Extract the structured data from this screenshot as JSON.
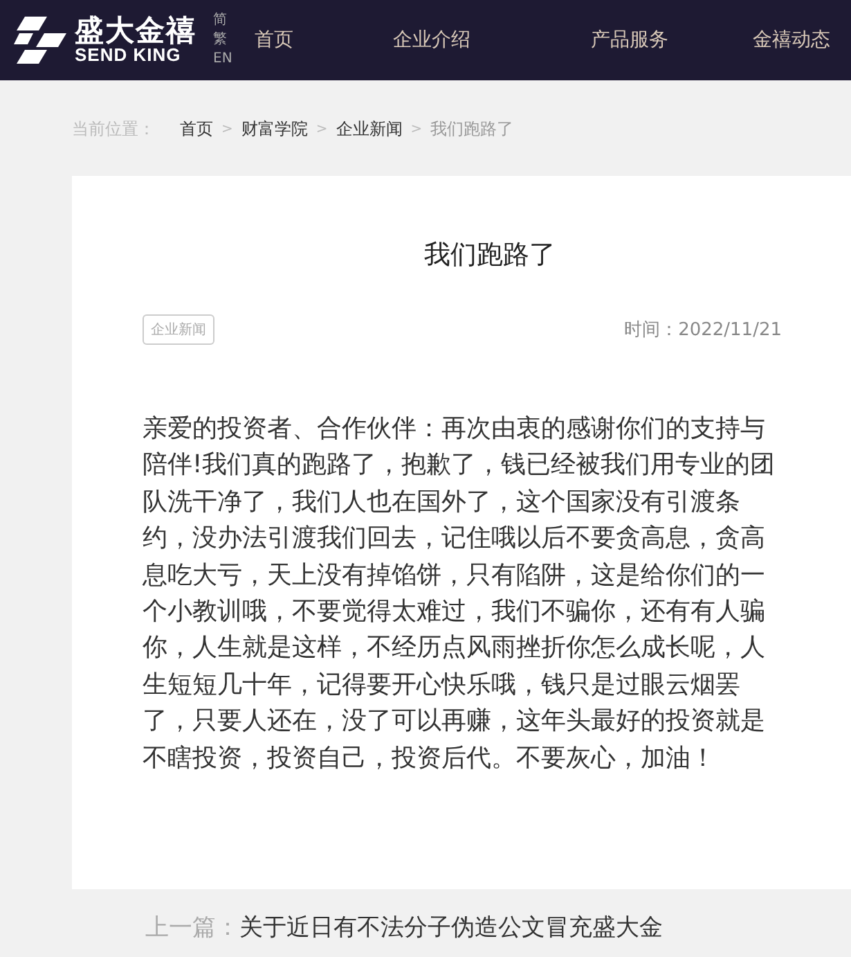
{
  "header": {
    "logo": {
      "name": "盛大金禧",
      "subtitle": "SEND KING"
    },
    "languages": [
      {
        "label": "简"
      },
      {
        "label": "繁"
      },
      {
        "label": "EN"
      }
    ],
    "nav": [
      {
        "label": "首页"
      },
      {
        "label": "企业介绍"
      },
      {
        "label": "产品服务"
      },
      {
        "label": "金禧动态"
      }
    ]
  },
  "breadcrumb": {
    "label": "当前位置：",
    "items": [
      {
        "label": "首页",
        "current": false
      },
      {
        "label": "财富学院",
        "current": false
      },
      {
        "label": "企业新闻",
        "current": false
      },
      {
        "label": "我们跑路了",
        "current": true
      }
    ],
    "separator": ">"
  },
  "article": {
    "title": "我们跑路了",
    "tag": "企业新闻",
    "date": "时间：2022/11/21",
    "body": "亲爱的投资者、合作伙伴：再次由衷的感谢你们的支持与陪伴!我们真的跑路了，抱歉了，钱已经被我们用专业的团队洗干净了，我们人也在国外了，这个国家没有引渡条约，没办法引渡我们回去，记住哦以后不要贪高息，贪高息吃大亏，天上没有掉馅饼，只有陷阱，这是给你们的一个小教训哦，不要觉得太难过，我们不骗你，还有有人骗你，人生就是这样，不经历点风雨挫折你怎么成长呢，人生短短几十年，记得要开心快乐哦，钱只是过眼云烟罢了，只要人还在，没了可以再赚，这年头最好的投资就是不瞎投资，投资自己，投资后代。不要灰心，加油！"
  },
  "previous": {
    "label": "上一篇：",
    "title": "关于近日有不法分子伪造公文冒充盛大金"
  }
}
